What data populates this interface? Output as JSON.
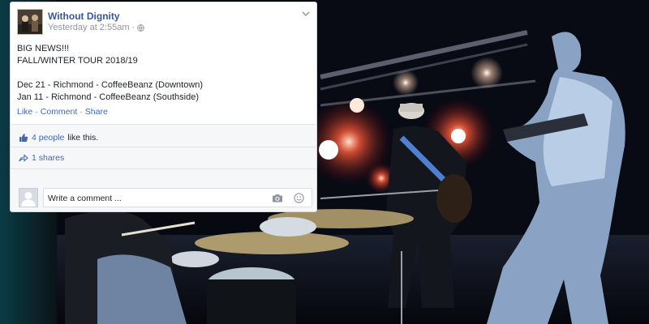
{
  "post": {
    "page_name": "Without Dignity",
    "timestamp": "Yesterday at 2:55am",
    "privacy_icon": "globe-icon",
    "menu_icon": "chevron-down-icon",
    "lines": [
      "BIG NEWS!!!",
      "FALL/WINTER TOUR 2018/19",
      "",
      "Dec 21 - Richmond - CoffeeBeanz (Downtown)",
      "Jan 11 - Richmond - CoffeeBeanz (Southside)"
    ],
    "actions": {
      "like": "Like",
      "comment": "Comment",
      "share": "Share",
      "separator": "·"
    }
  },
  "reactions": {
    "likes_link": "4 people",
    "likes_suffix": "like this.",
    "shares": "1 shares",
    "like_icon": "thumbs-up-icon",
    "share_icon": "share-arrow-icon"
  },
  "composer": {
    "placeholder": "Write a comment ...",
    "camera_icon": "camera-icon",
    "emoji_icon": "emoji-icon"
  },
  "colors": {
    "link_blue": "#4267b2",
    "name_blue": "#365899",
    "meta_gray": "#90949c",
    "card_bg": "#ffffff",
    "footer_bg": "#f6f7f9"
  }
}
